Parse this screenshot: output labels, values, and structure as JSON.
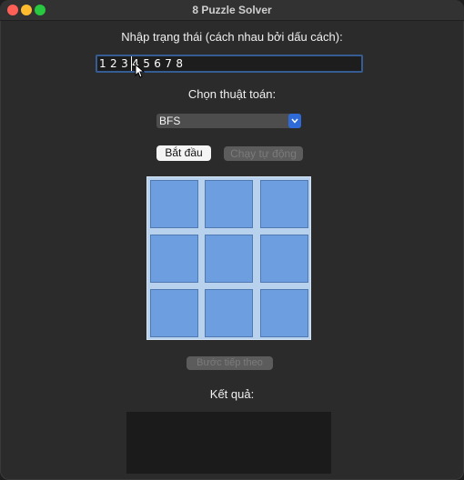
{
  "window": {
    "title": "8 Puzzle Solver"
  },
  "input": {
    "label": "Nhập trạng thái (cách nhau bởi dấu cách):",
    "value": "1 2 3 4 5 6 7 8"
  },
  "algorithm": {
    "label": "Chọn thuật toán:",
    "selected": "BFS"
  },
  "buttons": {
    "start": "Bắt đầu",
    "auto": "Chạy tự động",
    "step": "Bước tiếp theo"
  },
  "board": {
    "tiles": [
      "",
      "",
      "",
      "",
      "",
      "",
      "",
      "",
      ""
    ]
  },
  "result": {
    "label": "Kết quả:",
    "text": ""
  },
  "colors": {
    "tile": "#6d9ee0",
    "board": "#b8d2ee",
    "accent": "#2f6bd8"
  }
}
